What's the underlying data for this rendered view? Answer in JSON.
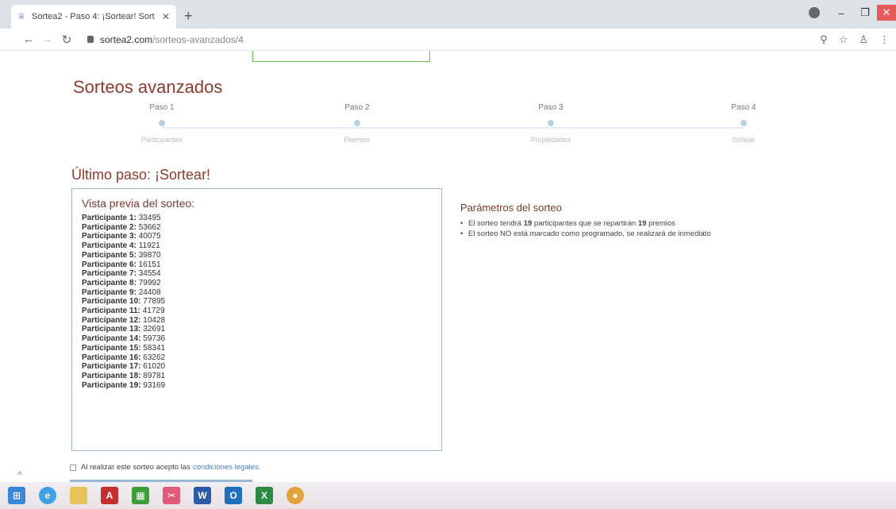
{
  "browser": {
    "tab_title": "Sortea2 - Paso 4: ¡Sortear! Sort",
    "url_host": "sortea2.com",
    "url_path": "/sorteos-avanzados/4"
  },
  "page": {
    "heading": "Sorteos avanzados",
    "steps": [
      {
        "label": "Paso 1",
        "sub": "Participantes"
      },
      {
        "label": "Paso 2",
        "sub": "Premios"
      },
      {
        "label": "Paso 3",
        "sub": "Propiedades"
      },
      {
        "label": "Paso 4",
        "sub": "Sortear"
      }
    ],
    "step_heading": "Último paso: ¡Sortear!",
    "preview_title": "Vista previa del sorteo:",
    "participants": [
      {
        "k": "Participante 1:",
        "v": "33495"
      },
      {
        "k": "Participante 2:",
        "v": "53662"
      },
      {
        "k": "Participante 3:",
        "v": "40075"
      },
      {
        "k": "Participante 4:",
        "v": "11921"
      },
      {
        "k": "Participante 5:",
        "v": "39870"
      },
      {
        "k": "Participante 6:",
        "v": "16151"
      },
      {
        "k": "Participante 7:",
        "v": "34554"
      },
      {
        "k": "Participante 8:",
        "v": "79992"
      },
      {
        "k": "Participante 9:",
        "v": "24408"
      },
      {
        "k": "Participante 10:",
        "v": "77895"
      },
      {
        "k": "Participante 11:",
        "v": "41729"
      },
      {
        "k": "Participante 12:",
        "v": "10428"
      },
      {
        "k": "Participante 13:",
        "v": "32691"
      },
      {
        "k": "Participante 14:",
        "v": "59736"
      },
      {
        "k": "Participante 15:",
        "v": "58341"
      },
      {
        "k": "Participante 16:",
        "v": "63262"
      },
      {
        "k": "Participante 17:",
        "v": "61020"
      },
      {
        "k": "Participante 18:",
        "v": "89781"
      },
      {
        "k": "Participante 19:",
        "v": "93169"
      }
    ],
    "params_title": "Parámetros del sorteo",
    "param1_pre": "El sorteo tendrá ",
    "param1_n1": "19",
    "param1_mid": " participantes que se repartirán ",
    "param1_n2": "19",
    "param1_post": " premios",
    "param2": "El sorteo NO está marcado como programado, se realizará de inmediato",
    "terms_text": "Al realizar este sorteo acepto las",
    "terms_link": "condiciones legales."
  },
  "icons": {
    "back": "arrow-left-icon",
    "forward": "arrow-right-icon",
    "reload": "reload-icon",
    "lock": "lock-icon",
    "zoom": "zoom-icon",
    "star": "star-icon",
    "account": "account-icon",
    "menu": "kebab-menu-icon"
  },
  "colors": {
    "heading": "#8c3b2f",
    "link": "#4a7fbf",
    "step_dot": "#b8d0e4"
  }
}
